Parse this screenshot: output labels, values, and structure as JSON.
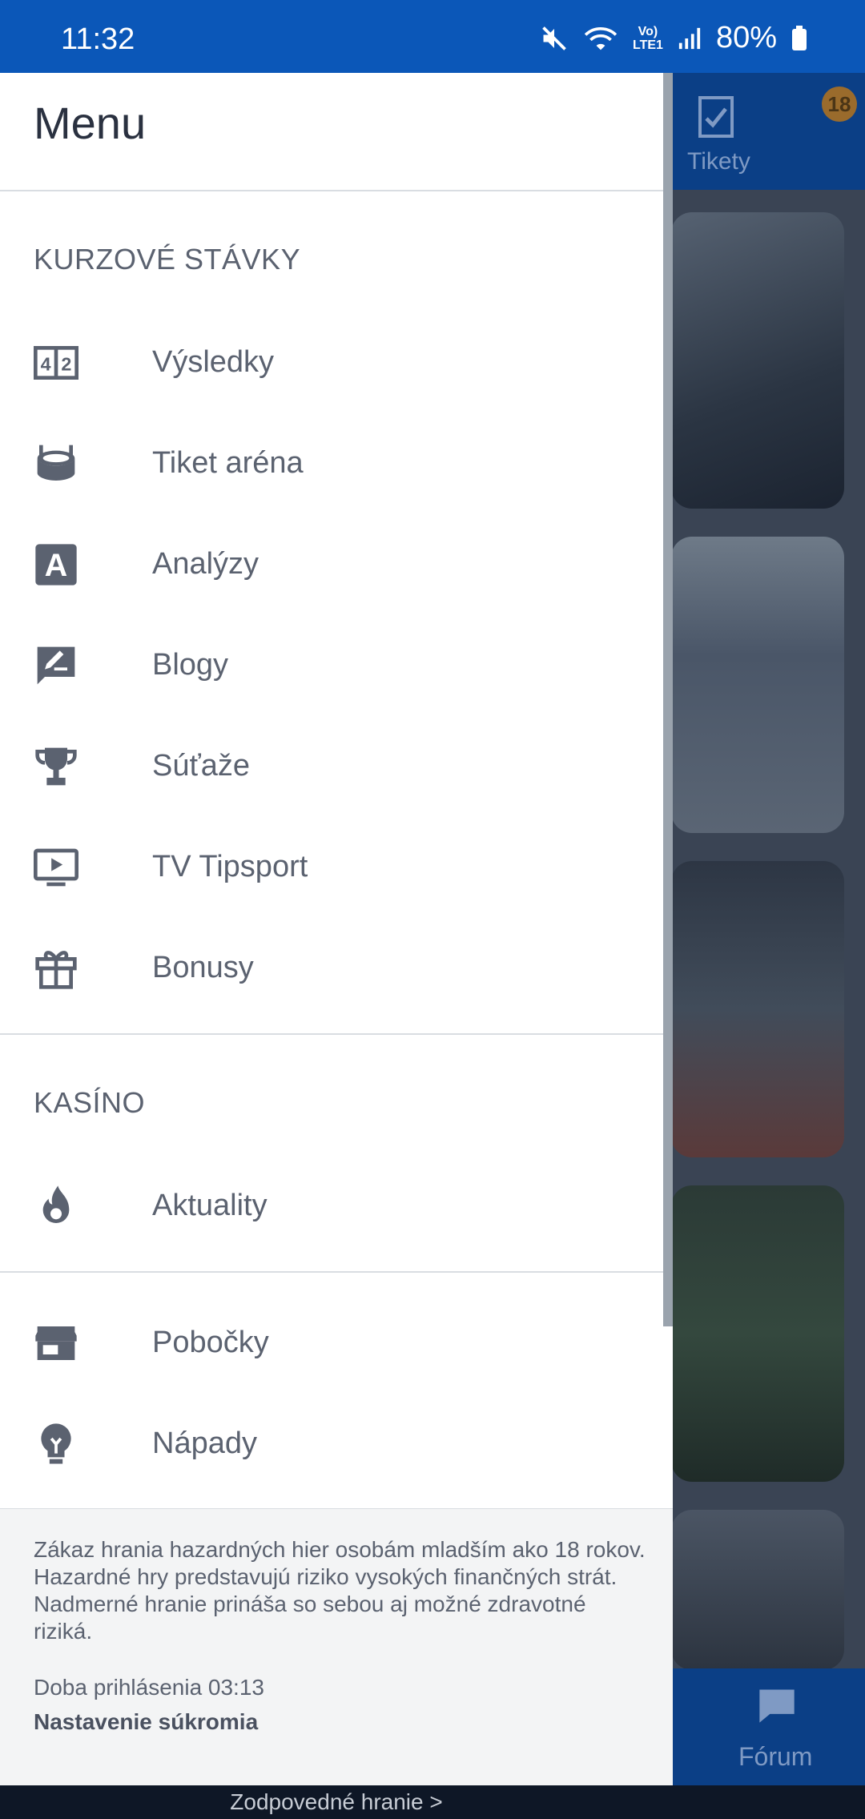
{
  "status_bar": {
    "time": "11:32",
    "network_top": "Vo)",
    "network_bottom": "LTE1",
    "battery": "80%"
  },
  "background": {
    "tab_label": "Tikety",
    "badge": "18",
    "footer_label": "Fórum"
  },
  "menu": {
    "title": "Menu",
    "sections": [
      {
        "title": "KURZOVÉ STÁVKY",
        "items": [
          {
            "label": "Výsledky",
            "icon": "scoreboard-icon"
          },
          {
            "label": "Tiket aréna",
            "icon": "stadium-icon"
          },
          {
            "label": "Analýzy",
            "icon": "letter-a-icon"
          },
          {
            "label": "Blogy",
            "icon": "edit-comment-icon"
          },
          {
            "label": "Súťaže",
            "icon": "trophy-icon"
          },
          {
            "label": "TV Tipsport",
            "icon": "tv-play-icon"
          },
          {
            "label": "Bonusy",
            "icon": "gift-icon"
          }
        ]
      },
      {
        "title": "KASÍNO",
        "items": [
          {
            "label": "Aktuality",
            "icon": "flame-icon"
          }
        ]
      },
      {
        "title": "",
        "items": [
          {
            "label": "Pobočky",
            "icon": "store-icon"
          },
          {
            "label": "Nápady",
            "icon": "lightbulb-icon"
          }
        ]
      }
    ]
  },
  "footer": {
    "warning_lines": [
      "Zákaz hrania hazardných hier osobám mladším ako 18 rokov.",
      "Hazardné hry predstavujú riziko vysokých finančných strát. Nadmerné hranie prináša so sebou aj možné zdravotné riziká."
    ],
    "session_time": "Doba prihlásenia 03:13",
    "privacy_link": "Nastavenie súkromia"
  },
  "bottom_bar": {
    "link": "Zodpovedné hranie >"
  },
  "colors": {
    "status_bar": "#0b57b8",
    "drawer_bg": "#ffffff",
    "text": "#5b6270",
    "footer_bg": "#f3f4f5"
  }
}
